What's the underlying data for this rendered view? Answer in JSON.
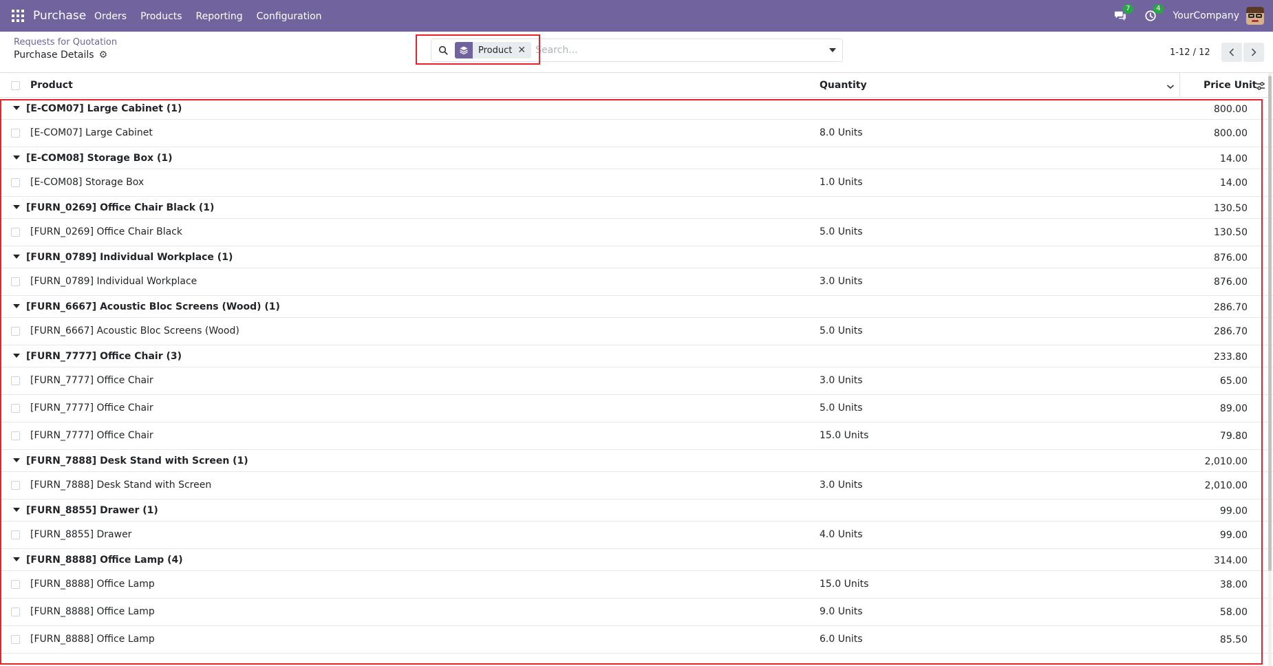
{
  "navbar": {
    "app_name": "Purchase",
    "menu": [
      "Orders",
      "Products",
      "Reporting",
      "Configuration"
    ],
    "messages_count": "7",
    "activities_count": "4",
    "company": "YourCompany"
  },
  "control_panel": {
    "breadcrumb": "Requests for Quotation",
    "title": "Purchase Details",
    "search": {
      "facet_label": "Product",
      "placeholder": "Search..."
    },
    "pager": "1-12 / 12"
  },
  "list": {
    "columns": {
      "product": "Product",
      "quantity": "Quantity",
      "price_unit": "Price Unit"
    },
    "groups": [
      {
        "label": "[E-COM07] Large Cabinet (1)",
        "price": "800.00",
        "rows": [
          {
            "product": "[E-COM07] Large Cabinet",
            "qty": "8.0 Units",
            "price": "800.00"
          }
        ]
      },
      {
        "label": "[E-COM08] Storage Box (1)",
        "price": "14.00",
        "rows": [
          {
            "product": "[E-COM08] Storage Box",
            "qty": "1.0 Units",
            "price": "14.00"
          }
        ]
      },
      {
        "label": "[FURN_0269] Office Chair Black (1)",
        "price": "130.50",
        "rows": [
          {
            "product": "[FURN_0269] Office Chair Black",
            "qty": "5.0 Units",
            "price": "130.50"
          }
        ]
      },
      {
        "label": "[FURN_0789] Individual Workplace (1)",
        "price": "876.00",
        "rows": [
          {
            "product": "[FURN_0789] Individual Workplace",
            "qty": "3.0 Units",
            "price": "876.00"
          }
        ]
      },
      {
        "label": "[FURN_6667] Acoustic Bloc Screens (Wood) (1)",
        "price": "286.70",
        "rows": [
          {
            "product": "[FURN_6667] Acoustic Bloc Screens (Wood)",
            "qty": "5.0 Units",
            "price": "286.70"
          }
        ]
      },
      {
        "label": "[FURN_7777] Office Chair (3)",
        "price": "233.80",
        "rows": [
          {
            "product": "[FURN_7777] Office Chair",
            "qty": "3.0 Units",
            "price": "65.00"
          },
          {
            "product": "[FURN_7777] Office Chair",
            "qty": "5.0 Units",
            "price": "89.00"
          },
          {
            "product": "[FURN_7777] Office Chair",
            "qty": "15.0 Units",
            "price": "79.80"
          }
        ]
      },
      {
        "label": "[FURN_7888] Desk Stand with Screen (1)",
        "price": "2,010.00",
        "rows": [
          {
            "product": "[FURN_7888] Desk Stand with Screen",
            "qty": "3.0 Units",
            "price": "2,010.00"
          }
        ]
      },
      {
        "label": "[FURN_8855] Drawer (1)",
        "price": "99.00",
        "rows": [
          {
            "product": "[FURN_8855] Drawer",
            "qty": "4.0 Units",
            "price": "99.00"
          }
        ]
      },
      {
        "label": "[FURN_8888] Office Lamp (4)",
        "price": "314.00",
        "rows": [
          {
            "product": "[FURN_8888] Office Lamp",
            "qty": "15.0 Units",
            "price": "38.00"
          },
          {
            "product": "[FURN_8888] Office Lamp",
            "qty": "9.0 Units",
            "price": "58.00"
          },
          {
            "product": "[FURN_8888] Office Lamp",
            "qty": "6.0 Units",
            "price": "85.50"
          }
        ]
      }
    ]
  },
  "colors": {
    "brand": "#71639e",
    "highlight": "#e8212a",
    "badge": "#28a745"
  }
}
